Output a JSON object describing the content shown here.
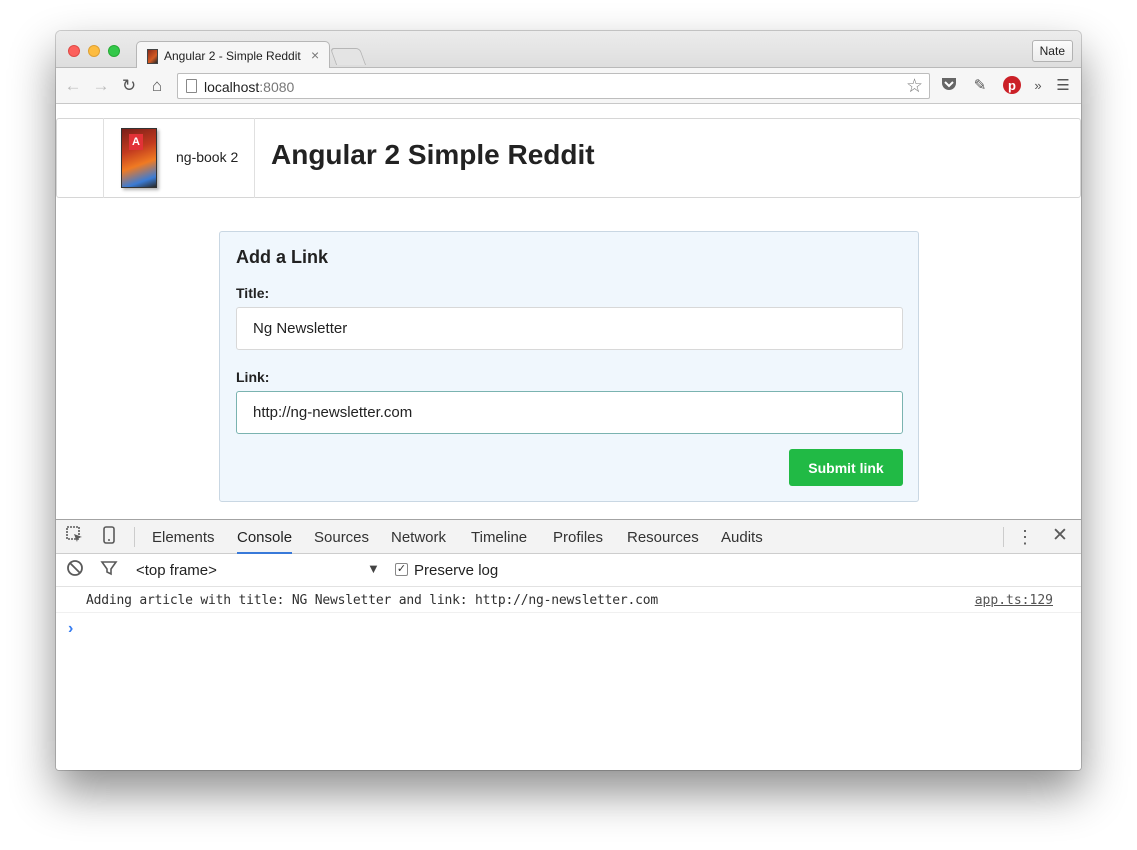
{
  "browser": {
    "tab_title": "Angular 2 - Simple Reddit",
    "tab_close": "×",
    "profile_name": "Nate",
    "url_host": "localhost",
    "url_port": ":8080",
    "icons": {
      "back": "back-arrow-icon",
      "forward": "forward-arrow-icon",
      "reload": "reload-icon",
      "home": "home-icon",
      "bookmark": "star-icon",
      "pocket": "pocket-icon",
      "pin": "pin-icon",
      "pinterest": "pinterest-icon",
      "overflow": "chevron-double-right-icon",
      "menu": "hamburger-menu-icon"
    }
  },
  "header": {
    "brand_name": "ng-book 2",
    "book_letter": "A",
    "title": "Angular 2 Simple Reddit"
  },
  "form": {
    "heading": "Add a Link",
    "title_label": "Title:",
    "title_value": "Ng Newsletter",
    "link_label": "Link:",
    "link_value": "http://ng-newsletter.com",
    "submit_label": "Submit link",
    "submit_color": "#21ba45"
  },
  "devtools": {
    "tabs": [
      "Elements",
      "Console",
      "Sources",
      "Network",
      "Timeline",
      "Profiles",
      "Resources",
      "Audits"
    ],
    "active_tab": "Console",
    "frame": "<top frame>",
    "preserve_log_label": "Preserve log",
    "preserve_log_checked": true,
    "console_message": "Adding article with title: NG Newsletter and link: http://ng-newsletter.com",
    "console_source": "app.ts:129",
    "prompt": "›",
    "accent_color": "#3879d9"
  }
}
